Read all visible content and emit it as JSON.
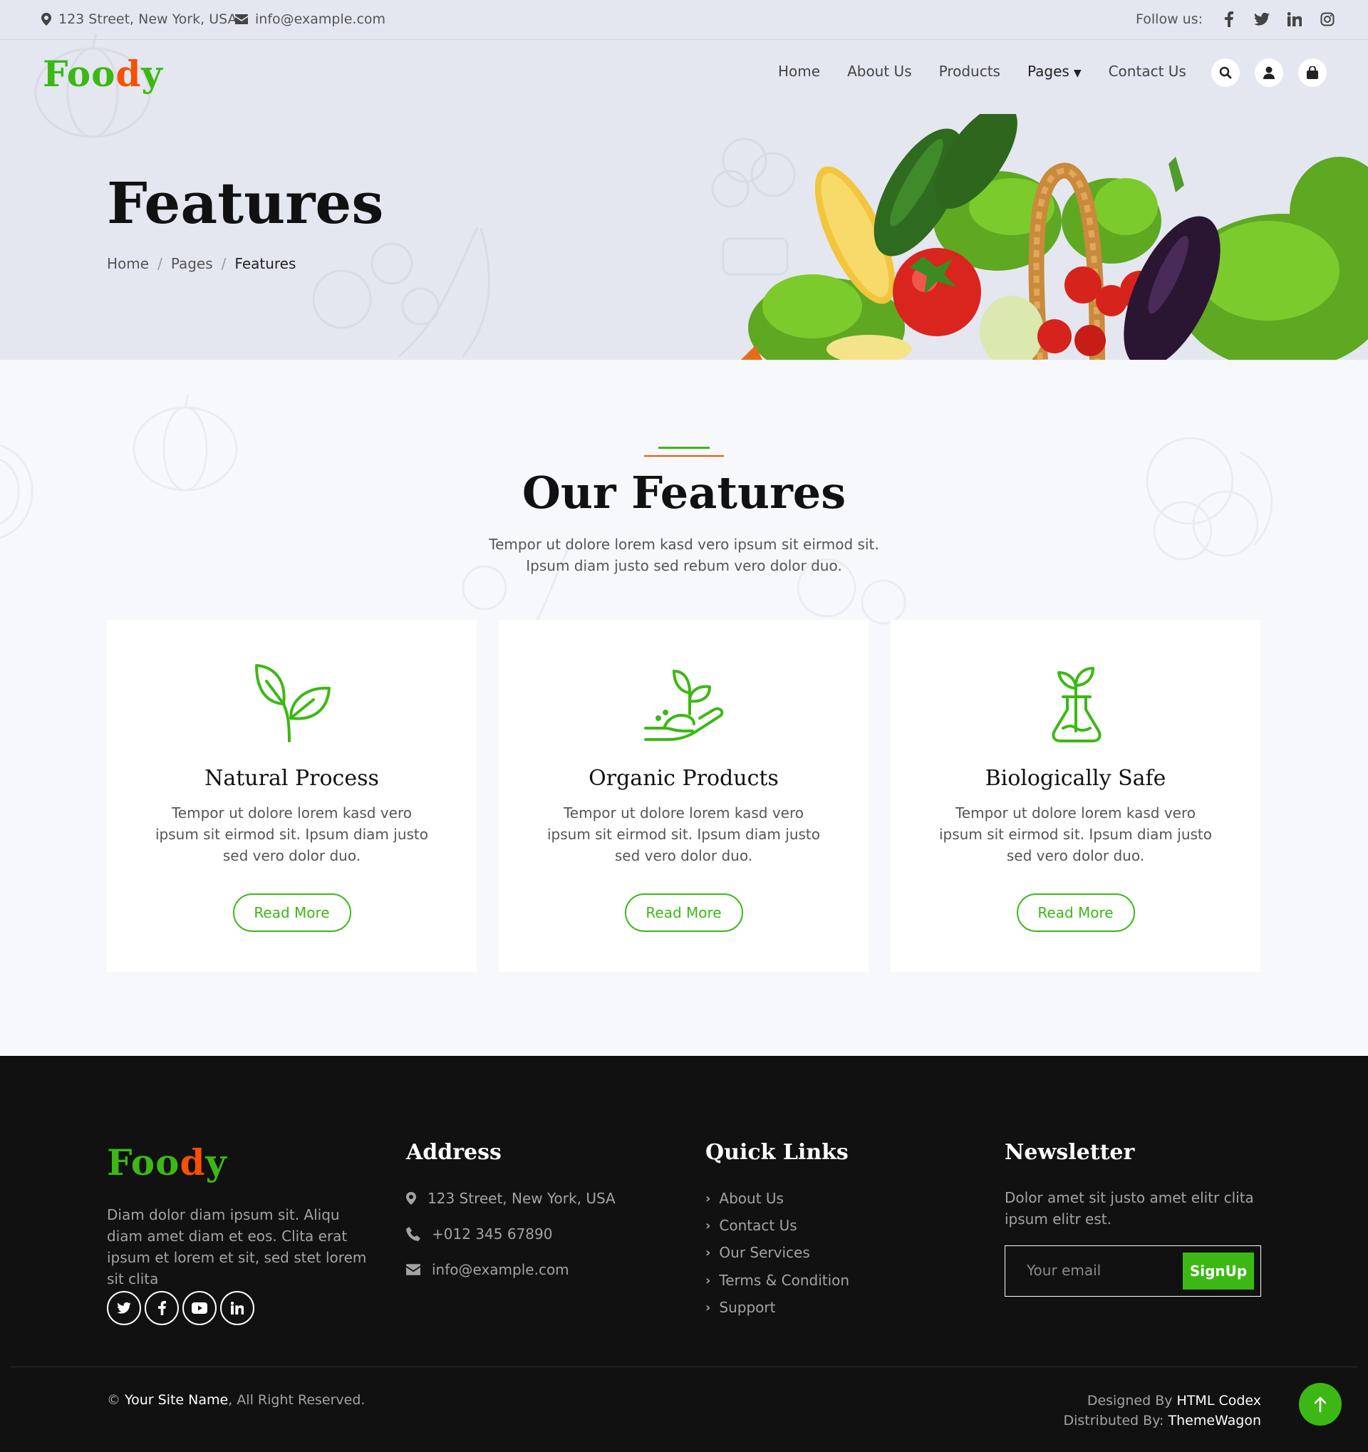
{
  "topbar": {
    "address": "123 Street, New York, USA",
    "email": "info@example.com",
    "follow_label": "Follow us:",
    "social": [
      "f",
      "t",
      "in",
      "ig"
    ]
  },
  "brand": {
    "part1": "Foo",
    "part2": "d",
    "part3": "y"
  },
  "nav": {
    "items": [
      "Home",
      "About Us",
      "Products",
      "Pages",
      "Contact Us"
    ],
    "buttons": [
      "search-icon",
      "user-icon",
      "bag-icon"
    ]
  },
  "hero": {
    "title": "Features",
    "breadcrumb": [
      "Home",
      "Pages",
      "Features"
    ],
    "separator": "/"
  },
  "features_section": {
    "title": "Our Features",
    "subtitle": "Tempor ut dolore lorem kasd vero ipsum sit eirmod sit. Ipsum diam justo sed rebum vero dolor duo.",
    "cards": [
      {
        "icon": "plant-sprout-icon",
        "title": "Natural Process",
        "text": "Tempor ut dolore lorem kasd vero ipsum sit eirmod sit. Ipsum diam justo sed vero dolor duo.",
        "button": "Read More"
      },
      {
        "icon": "hand-plant-icon",
        "title": "Organic Products",
        "text": "Tempor ut dolore lorem kasd vero ipsum sit eirmod sit. Ipsum diam justo sed vero dolor duo.",
        "button": "Read More"
      },
      {
        "icon": "flask-plant-icon",
        "title": "Biologically Safe",
        "text": "Tempor ut dolore lorem kasd vero ipsum sit eirmod sit. Ipsum diam justo sed vero dolor duo.",
        "button": "Read More"
      }
    ]
  },
  "footer": {
    "about_text": "Diam dolor diam ipsum sit. Aliqu diam amet diam et eos. Clita erat ipsum et lorem et sit, sed stet lorem sit clita",
    "social": [
      "twitter-icon",
      "facebook-icon",
      "youtube-icon",
      "linkedin-icon"
    ],
    "address_title": "Address",
    "address": "123 Street, New York, USA",
    "phone": "+012 345 67890",
    "email": "info@example.com",
    "links_title": "Quick Links",
    "links": [
      "About Us",
      "Contact Us",
      "Our Services",
      "Terms & Condition",
      "Support"
    ],
    "newsletter_title": "Newsletter",
    "newsletter_text": "Dolor amet sit justo amet elitr clita ipsum elitr est.",
    "email_placeholder": "Your email",
    "signup": "SignUp",
    "copyright_symbol": "©",
    "site_name": "Your Site Name",
    "rights": ", All Right Reserved.",
    "designed_label": "Designed By",
    "designed_by": "HTML Codex",
    "distributed_label": "Distributed By:",
    "distributed_by": "ThemeWagon"
  },
  "colors": {
    "green": "#3cb815",
    "orange": "#f65005",
    "dark": "#111111",
    "light_bg": "#f7f8fc",
    "hero_bg": "#e4e7ef"
  }
}
